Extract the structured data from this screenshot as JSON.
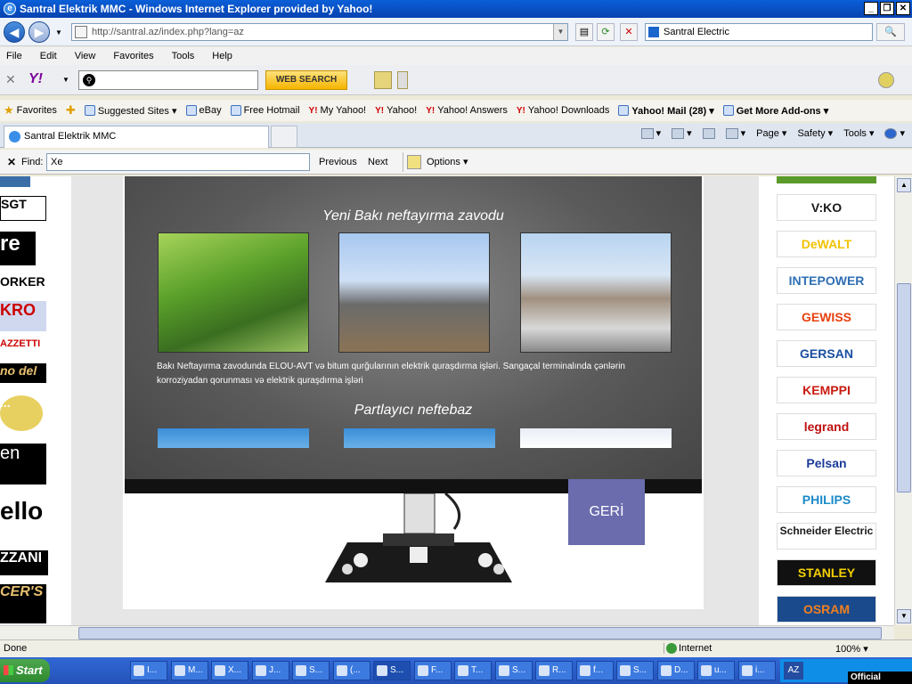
{
  "window": {
    "title": "Santral Elektrik MMC - Windows Internet Explorer provided by Yahoo!",
    "controls": [
      "_",
      "❐",
      "✕"
    ]
  },
  "address_bar": {
    "url": "http://santral.az/index.php?lang=az",
    "search_value": "Santral Electric"
  },
  "menu": [
    "File",
    "Edit",
    "View",
    "Favorites",
    "Tools",
    "Help"
  ],
  "yahoo_toolbar": {
    "logo": "Y!",
    "search_button": "WEB SEARCH"
  },
  "favorites_bar": {
    "favorites_label": "Favorites",
    "items": [
      "Suggested Sites ▾",
      "eBay",
      "Free Hotmail",
      "My Yahoo!",
      "Yahoo!",
      "Yahoo! Answers",
      "Yahoo! Downloads",
      "Yahoo! Mail (28) ▾",
      "Get More Add-ons ▾"
    ]
  },
  "tabs": {
    "active": "Santral Elektrik MMC",
    "commands": [
      "Page ▾",
      "Safety ▾",
      "Tools ▾"
    ]
  },
  "find_bar": {
    "label": "Find:",
    "value": "Xe",
    "previous": "Previous",
    "next": "Next",
    "options": "Options ▾"
  },
  "page": {
    "section_title_1": "Yeni Bakı neftayırma zavodu",
    "caption": "Bakı Neftayırma zavodunda ELOU-AVT və bitum qurğularının elektrik quraşdırma işləri. Sangaçal terminalında çənlərin korroziyadan qorunması və elektrik quraşdırma işləri",
    "section_title_2": "Partlayıcı neftebaz",
    "back_button": "GERİ",
    "left_logos": [
      "SGT",
      "re",
      "ORKER",
      "KRO",
      "AZZETTI",
      "no del",
      "...",
      "en",
      "ello",
      "ZZANI",
      "CER'S"
    ],
    "brands": [
      "V:KO",
      "DeWALT",
      "INTEPOWER",
      "GEWISS",
      "GERSAN",
      "KEMPPI",
      "legrand",
      "Pelsan",
      "PHILIPS",
      "Schneider Electric",
      "STANLEY",
      "OSRAM"
    ],
    "brand_colors": [
      "#1a1a1a",
      "#f2c200",
      "#2f6fb4",
      "#e84010",
      "#1a4fa0",
      "#c81a10",
      "#c01010",
      "#1a3a9a",
      "#1a8ac8",
      "#1a1a1a",
      "#111111",
      "#1a4a8c"
    ]
  },
  "status_bar": {
    "text": "Done",
    "zone": "Internet",
    "zoom": "100% ▾"
  },
  "taskbar": {
    "start": "Start",
    "items": [
      "I...",
      "M...",
      "X...",
      "J...",
      "S...",
      "(...",
      "S...",
      "F...",
      "T...",
      "S...",
      "R...",
      "f...",
      "S...",
      "D...",
      "u...",
      "i..."
    ],
    "language": "AZ",
    "overlay_label": "Official website"
  }
}
